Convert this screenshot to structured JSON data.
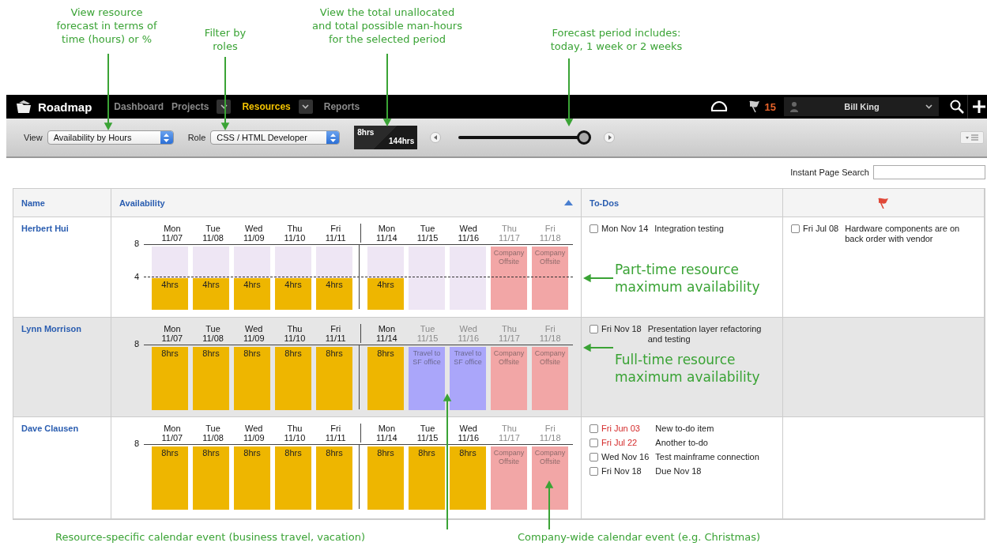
{
  "annotations": {
    "top": [
      {
        "text": "View resource\nforecast in terms of\ntime (hours) or %"
      },
      {
        "text": "Filter by\nroles"
      },
      {
        "text": "View the total unallocated\nand total possible man-hours\nfor the selected period"
      },
      {
        "text": "Forecast period includes:\ntoday, 1 week or 2 weeks"
      }
    ],
    "side": [
      "Part-time resource\nmaximum availability",
      "Full-time resource\nmaximum availability"
    ],
    "bottom": [
      "Resource-specific calendar event (business travel, vacation)",
      "Company-wide calendar event (e.g. Christmas)"
    ]
  },
  "nav": {
    "logo": "Roadmap",
    "items": [
      {
        "label": "Dashboard",
        "selected": false,
        "dropdown": false
      },
      {
        "label": "Projects",
        "selected": false,
        "dropdown": true
      },
      {
        "label": "Resources",
        "selected": true,
        "dropdown": true
      },
      {
        "label": "Reports",
        "selected": false,
        "dropdown": false
      }
    ],
    "notifications": "15",
    "user": "Bill King"
  },
  "toolbar": {
    "view_label": "View",
    "view_value": "Availability by Hours",
    "role_label": "Role",
    "role_value": "CSS / HTML Developer",
    "unallocated": "8hrs",
    "total": "144hrs",
    "period_slider": {
      "level": 1
    }
  },
  "search": {
    "label": "Instant Page Search"
  },
  "table": {
    "columns": [
      {
        "label": "Name",
        "sorted": false
      },
      {
        "label": "Availability",
        "sorted": true
      },
      {
        "label": "To-Dos",
        "sorted": false
      }
    ],
    "rows": [
      {
        "name": "Herbert Hui",
        "highlighted": false,
        "top_tick": "8",
        "limit": {
          "tick": "4",
          "level": 0.5
        },
        "days": [
          {
            "day": "Mon",
            "date": "11/07",
            "kind": "work",
            "label": "4hrs",
            "level": 0.5
          },
          {
            "day": "Tue",
            "date": "11/08",
            "kind": "work",
            "label": "4hrs",
            "level": 0.5
          },
          {
            "day": "Wed",
            "date": "11/09",
            "kind": "work",
            "label": "4hrs",
            "level": 0.5
          },
          {
            "day": "Thu",
            "date": "11/10",
            "kind": "work",
            "label": "4hrs",
            "level": 0.5
          },
          {
            "day": "Fri",
            "date": "11/11",
            "kind": "work",
            "label": "4hrs",
            "level": 0.5
          },
          {
            "day": "Mon",
            "date": "11/14",
            "kind": "work",
            "label": "4hrs",
            "level": 0.5
          },
          {
            "day": "Tue",
            "date": "11/15",
            "kind": "free"
          },
          {
            "day": "Wed",
            "date": "11/16",
            "kind": "free"
          },
          {
            "day": "Thu",
            "date": "11/17",
            "kind": "offsite",
            "label": "Company Offsite",
            "level": 1
          },
          {
            "day": "Fri",
            "date": "11/18",
            "kind": "offsite",
            "label": "Company Offsite",
            "level": 1
          }
        ],
        "todos": [
          {
            "date": "Mon Nov 14",
            "text": "Integration testing",
            "overdue": false,
            "checked": false
          }
        ],
        "flagged": [
          {
            "date": "Fri Jul 08",
            "text": "Hardware components are on back order with vendor",
            "checked": false
          }
        ]
      },
      {
        "name": "Lynn Morrison",
        "highlighted": true,
        "top_tick": "8",
        "days": [
          {
            "day": "Mon",
            "date": "11/07",
            "kind": "work",
            "label": "8hrs",
            "level": 1
          },
          {
            "day": "Tue",
            "date": "11/08",
            "kind": "work",
            "label": "8hrs",
            "level": 1
          },
          {
            "day": "Wed",
            "date": "11/09",
            "kind": "work",
            "label": "8hrs",
            "level": 1
          },
          {
            "day": "Thu",
            "date": "11/10",
            "kind": "work",
            "label": "8hrs",
            "level": 1
          },
          {
            "day": "Fri",
            "date": "11/11",
            "kind": "work",
            "label": "8hrs",
            "level": 1
          },
          {
            "day": "Mon",
            "date": "11/14",
            "kind": "work",
            "label": "8hrs",
            "level": 1
          },
          {
            "day": "Tue",
            "date": "11/15",
            "kind": "travel",
            "label": "Travel to SF office",
            "level": 1
          },
          {
            "day": "Wed",
            "date": "11/16",
            "kind": "travel",
            "label": "Travel to SF office",
            "level": 1
          },
          {
            "day": "Thu",
            "date": "11/17",
            "kind": "offsite",
            "label": "Company Offsite",
            "level": 1
          },
          {
            "day": "Fri",
            "date": "11/18",
            "kind": "offsite",
            "label": "Company Offsite",
            "level": 1
          }
        ],
        "todos": [
          {
            "date": "Fri Nov 18",
            "text": "Presentation layer refactoring and testing",
            "overdue": false,
            "checked": false
          }
        ],
        "flagged": []
      },
      {
        "name": "Dave Clausen",
        "highlighted": false,
        "top_tick": "8",
        "days": [
          {
            "day": "Mon",
            "date": "11/07",
            "kind": "work",
            "label": "8hrs",
            "level": 1
          },
          {
            "day": "Tue",
            "date": "11/08",
            "kind": "work",
            "label": "8hrs",
            "level": 1
          },
          {
            "day": "Wed",
            "date": "11/09",
            "kind": "work",
            "label": "8hrs",
            "level": 1
          },
          {
            "day": "Thu",
            "date": "11/10",
            "kind": "work",
            "label": "8hrs",
            "level": 1
          },
          {
            "day": "Fri",
            "date": "11/11",
            "kind": "work",
            "label": "8hrs",
            "level": 1
          },
          {
            "day": "Mon",
            "date": "11/14",
            "kind": "work",
            "label": "8hrs",
            "level": 1
          },
          {
            "day": "Tue",
            "date": "11/15",
            "kind": "work",
            "label": "8hrs",
            "level": 1
          },
          {
            "day": "Wed",
            "date": "11/16",
            "kind": "work",
            "label": "8hrs",
            "level": 1
          },
          {
            "day": "Thu",
            "date": "11/17",
            "kind": "offsite",
            "label": "Company Offsite",
            "level": 1
          },
          {
            "day": "Fri",
            "date": "11/18",
            "kind": "offsite",
            "label": "Company Offsite",
            "level": 1
          }
        ],
        "todos": [
          {
            "date": "Fri Jun 03",
            "text": "New to-do item",
            "overdue": true,
            "checked": false
          },
          {
            "date": "Fri Jul 22",
            "text": "Another to-do",
            "overdue": true,
            "checked": false
          },
          {
            "date": "Wed Nov 16",
            "text": "Test mainframe connection",
            "overdue": false,
            "checked": false
          },
          {
            "date": "Fri Nov 18",
            "text": "Due Nov 18",
            "overdue": false,
            "checked": false
          }
        ],
        "flagged": []
      }
    ]
  }
}
